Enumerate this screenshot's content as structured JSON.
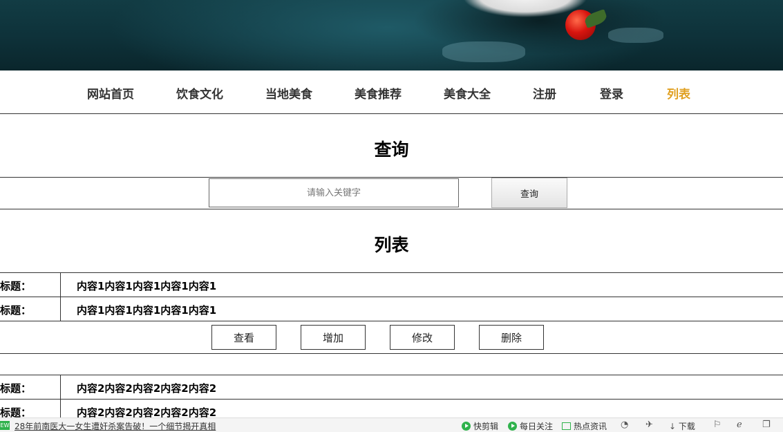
{
  "nav": {
    "items": [
      {
        "label": "网站首页",
        "active": false
      },
      {
        "label": "饮食文化",
        "active": false
      },
      {
        "label": "当地美食",
        "active": false
      },
      {
        "label": "美食推荐",
        "active": false
      },
      {
        "label": "美食大全",
        "active": false
      },
      {
        "label": "注册",
        "active": false
      },
      {
        "label": "登录",
        "active": false
      },
      {
        "label": "列表",
        "active": true
      }
    ],
    "active_color": "#e0a021"
  },
  "search": {
    "title": "查询",
    "placeholder": "请输入关键字",
    "button_label": "查询"
  },
  "list": {
    "title": "列表",
    "entries": [
      {
        "rows": [
          {
            "label": "标题：",
            "value": "内容1内容1内容1内容1内容1"
          },
          {
            "label": "标题：",
            "value": "内容1内容1内容1内容1内容1"
          }
        ],
        "actions": {
          "view": "查看",
          "add": "增加",
          "edit": "修改",
          "delete": "删除"
        }
      },
      {
        "rows": [
          {
            "label": "标题：",
            "value": "内容2内容2内容2内容2内容2"
          },
          {
            "label": "标题：",
            "value": "内容2内容2内容2内容2内容2"
          }
        ]
      }
    ]
  },
  "statusbar": {
    "news_badge": "EW",
    "news_text": "28年前南医大一女生遭奸杀案告破！一个细节揭开真相",
    "items": {
      "quick_clip": "快剪辑",
      "daily_follow": "每日关注",
      "hot_news": "热点资讯",
      "download": "下载"
    }
  }
}
